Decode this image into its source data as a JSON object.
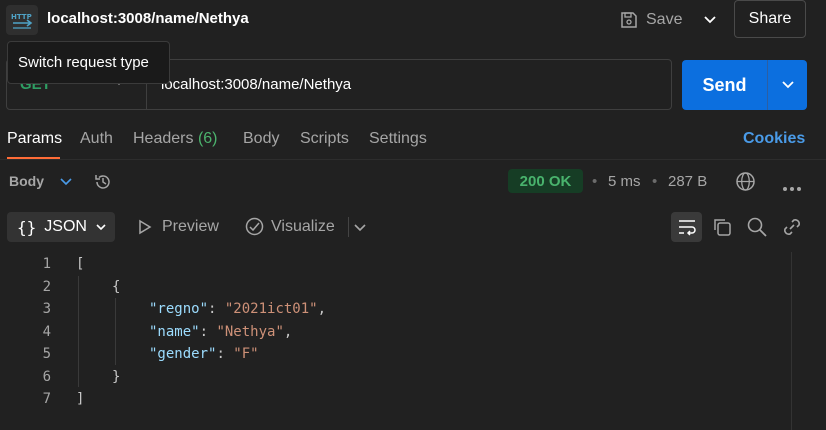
{
  "header": {
    "method_badge": "HTTP",
    "title": "localhost:3008/name/Nethya",
    "save_label": "Save",
    "share_label": "Share"
  },
  "request": {
    "method": "GET",
    "url": "localhost:3008/name/Nethya",
    "send_label": "Send",
    "tooltip": "Switch request type"
  },
  "tabs": [
    {
      "label": "Params",
      "active": true
    },
    {
      "label": "Auth"
    },
    {
      "label": "Headers",
      "count": "(6)"
    },
    {
      "label": "Body"
    },
    {
      "label": "Scripts"
    },
    {
      "label": "Settings"
    }
  ],
  "cookies_label": "Cookies",
  "response": {
    "body_label": "Body",
    "status": "200 OK",
    "time": "5 ms",
    "size": "287 B",
    "format": "JSON",
    "preview_label": "Preview",
    "visualize_label": "Visualize"
  },
  "code": {
    "line_numbers": [
      "1",
      "2",
      "3",
      "4",
      "5",
      "6",
      "7"
    ],
    "open_bracket": "[",
    "open_brace": "{",
    "fields": [
      {
        "key": "\"regno\"",
        "value": "\"2021ict01\"",
        "sep": ": ",
        "comma": ","
      },
      {
        "key": "\"name\"",
        "value": "\"Nethya\"",
        "sep": ": ",
        "comma": ","
      },
      {
        "key": "\"gender\"",
        "value": "\"F\"",
        "sep": ": ",
        "comma": ""
      }
    ],
    "close_brace": "}",
    "close_bracket": "]"
  },
  "colors": {
    "accent": "#ff6c37",
    "send": "#0c6fdf",
    "status_ok": "#49b36d",
    "link": "#4a9be8"
  }
}
